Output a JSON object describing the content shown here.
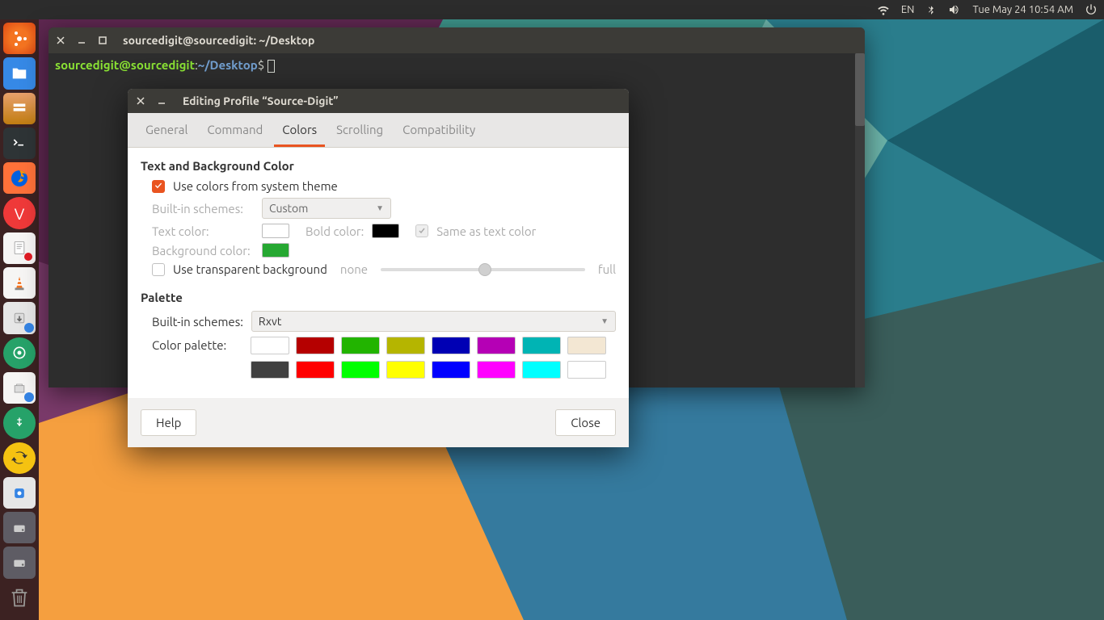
{
  "top_panel": {
    "lang": "EN",
    "datetime": "Tue May 24 10:54 AM"
  },
  "terminal": {
    "title": "sourcedigit@sourcedigit: ~/Desktop",
    "prompt_user": "sourcedigit@sourcedigit",
    "prompt_sep": ":",
    "prompt_path": "~/Desktop",
    "prompt_symbol": "$"
  },
  "dialog": {
    "title": "Editing Profile “Source-Digit”",
    "tabs": {
      "general": "General",
      "command": "Command",
      "colors": "Colors",
      "scrolling": "Scrolling",
      "compatibility": "Compatibility"
    },
    "section_text_bg": "Text and Background Color",
    "use_system_theme": "Use colors from system theme",
    "builtin_schemes_label": "Built-in schemes:",
    "builtin_schemes_value": "Custom",
    "text_color_label": "Text color:",
    "bold_color_label": "Bold color:",
    "same_as_text": "Same as text color",
    "background_color_label": "Background color:",
    "use_transparent": "Use transparent background",
    "slider_none": "none",
    "slider_full": "full",
    "section_palette": "Palette",
    "palette_builtin_label": "Built-in schemes:",
    "palette_builtin_value": "Rxvt",
    "color_palette_label": "Color palette:",
    "colors_bg": {
      "text": "#ffffff",
      "bold": "#000000",
      "background": "#26a832"
    },
    "palette_row1": [
      "#ffffff",
      "#b50000",
      "#22b400",
      "#b5b500",
      "#0000b4",
      "#b500b5",
      "#00b4b4",
      "#f3e7d3"
    ],
    "palette_row2": [
      "#404040",
      "#ff0000",
      "#00ff00",
      "#ffff00",
      "#0000ff",
      "#ff00ff",
      "#00ffff",
      "#ffffff"
    ],
    "help": "Help",
    "close": "Close"
  }
}
